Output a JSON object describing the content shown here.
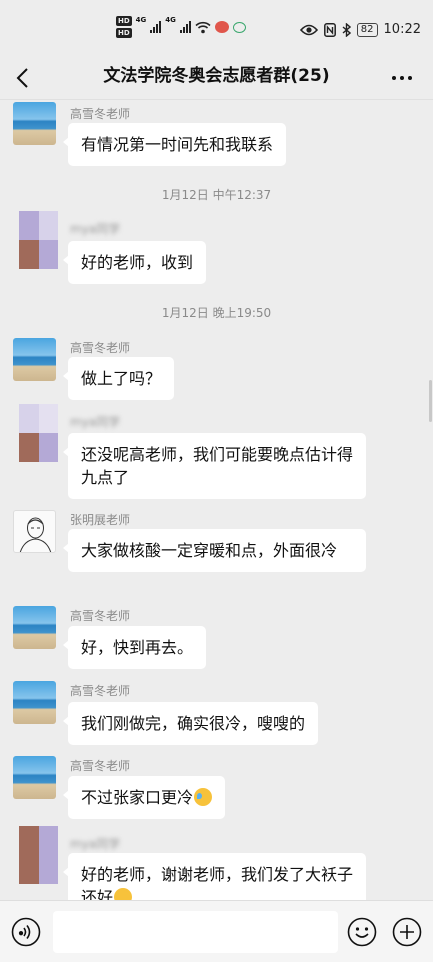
{
  "status_bar": {
    "hd1": "HD",
    "hd2": "HD",
    "net1": "4G",
    "net2": "4G",
    "battery": "82",
    "time": "10:22"
  },
  "header": {
    "title": "文法学院冬奥会志愿者群(25)"
  },
  "timestamps": {
    "t1": "1月12日 中午12:37",
    "t2": "1月12日 晚上19:50"
  },
  "messages": [
    {
      "sender": "高雪冬老师",
      "text": "有情况第一时间先和我联系",
      "avatar": "beach-avatar"
    },
    {
      "sender": "mya同学",
      "text": "好的老师，收到",
      "avatar": "pixel-avatar"
    },
    {
      "sender": "高雪冬老师",
      "text": "做上了吗？",
      "avatar": "beach-avatar"
    },
    {
      "sender": "mya同学",
      "text": "还没呢高老师，我们可能要晚点估计得九点了",
      "avatar": "pixel-avatar"
    },
    {
      "sender": "张明展老师",
      "text": "大家做核酸一定穿暖和点，外面很冷",
      "avatar": "sketch-avatar"
    },
    {
      "sender": "高雪冬老师",
      "text": "好，快到再去。",
      "avatar": "beach-avatar"
    },
    {
      "sender": "高雪冬老师",
      "text": "我们刚做完，确实很冷，嗖嗖的",
      "avatar": "beach-avatar"
    },
    {
      "sender": "高雪冬老师",
      "text": "不过张家口更冷",
      "avatar": "beach-avatar"
    },
    {
      "sender": "mya同学",
      "text": "好的老师，谢谢老师，我们发了大袄子还好",
      "avatar": "pixel-avatar"
    }
  ],
  "colors": {
    "background": "#ededed",
    "bubble": "#ffffff",
    "pixel_a": "#b4a9d6",
    "pixel_b": "#a06a5a",
    "pixel_c": "#fad7d2",
    "pixel_d": "#ef8a7e"
  },
  "input_bar": {
    "icons": [
      "voice-icon",
      "emoji-icon",
      "plus-icon"
    ]
  }
}
